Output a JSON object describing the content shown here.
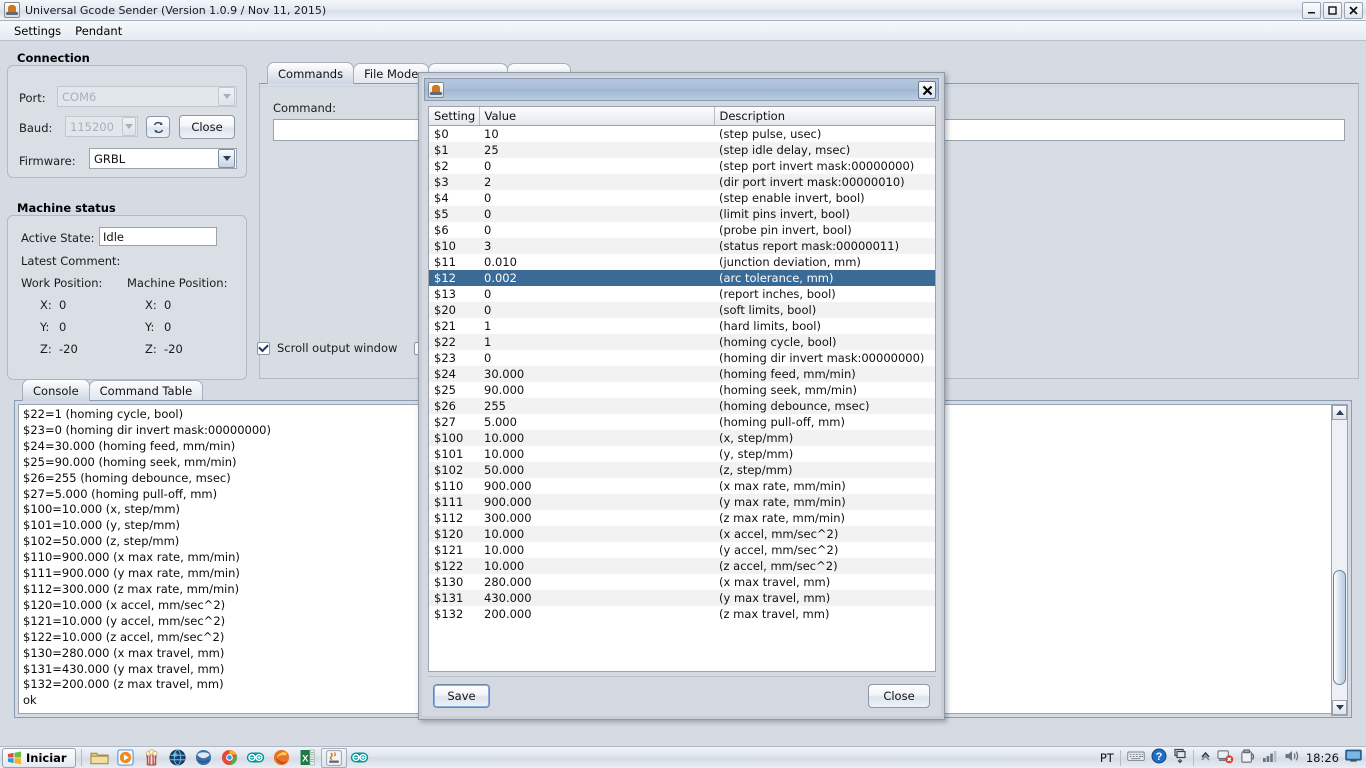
{
  "window": {
    "title": "Universal Gcode Sender (Version 1.0.9 / Nov 11, 2015)",
    "icon": "java-coffee-cup-icon",
    "controls": {
      "minimize": "_",
      "maximize": "□",
      "close": "✕"
    }
  },
  "menubar": {
    "items": [
      "Settings",
      "Pendant"
    ]
  },
  "connection": {
    "title": "Connection",
    "port_label": "Port:",
    "port_value": "COM6",
    "baud_label": "Baud:",
    "baud_value": "115200",
    "refresh_icon": "refresh-icon",
    "close_button": "Close",
    "firmware_label": "Firmware:",
    "firmware_value": "GRBL"
  },
  "machine_status": {
    "title": "Machine status",
    "active_state_label": "Active State:",
    "active_state_value": "Idle",
    "latest_comment_label": "Latest Comment:",
    "work_position_label": "Work Position:",
    "machine_position_label": "Machine Position:",
    "work": {
      "x_label": "X:",
      "x": "0",
      "y_label": "Y:",
      "y": "0",
      "z_label": "Z:",
      "z": "-20"
    },
    "machine": {
      "x_label": "X:",
      "x": "0",
      "y_label": "Y:",
      "y": "0",
      "z_label": "Z:",
      "z": "-20"
    }
  },
  "main_tabs": [
    {
      "label": "Commands",
      "selected": true
    },
    {
      "label": "File Mode",
      "selected": false
    },
    {
      "label": "",
      "selected": false
    },
    {
      "label": "",
      "selected": false
    }
  ],
  "command_panel": {
    "label": "Command:",
    "input_value": "",
    "input_placeholder": ""
  },
  "options": {
    "scroll_output_window": {
      "label": "Scroll output window",
      "checked": true
    },
    "second_checkbox": {
      "label": "",
      "checked": false
    }
  },
  "bottom_tabs": [
    {
      "label": "Console",
      "selected": true
    },
    {
      "label": "Command Table",
      "selected": false
    }
  ],
  "console": {
    "lines": [
      "$22=1 (homing cycle, bool)",
      "$23=0 (homing dir invert mask:00000000)",
      "$24=30.000 (homing feed, mm/min)",
      "$25=90.000 (homing seek, mm/min)",
      "$26=255 (homing debounce, msec)",
      "$27=5.000 (homing pull-off, mm)",
      "$100=10.000 (x, step/mm)",
      "$101=10.000 (y, step/mm)",
      "$102=50.000 (z, step/mm)",
      "$110=900.000 (x max rate, mm/min)",
      "$111=900.000 (y max rate, mm/min)",
      "$112=300.000 (z max rate, mm/min)",
      "$120=10.000 (x accel, mm/sec^2)",
      "$121=10.000 (y accel, mm/sec^2)",
      "$122=10.000 (z accel, mm/sec^2)",
      "$130=280.000 (x max travel, mm)",
      "$131=430.000 (y max travel, mm)",
      "$132=200.000 (z max travel, mm)",
      "ok"
    ]
  },
  "dialog": {
    "title": "",
    "icon": "java-coffee-cup-icon",
    "close_icon": "close-icon",
    "columns": [
      "Setting",
      "Value",
      "Description"
    ],
    "selected_row": 9,
    "rows": [
      [
        "$0",
        "10",
        "(step pulse, usec)"
      ],
      [
        "$1",
        "25",
        "(step idle delay, msec)"
      ],
      [
        "$2",
        "0",
        "(step port invert mask:00000000)"
      ],
      [
        "$3",
        "2",
        "(dir port invert mask:00000010)"
      ],
      [
        "$4",
        "0",
        "(step enable invert, bool)"
      ],
      [
        "$5",
        "0",
        "(limit pins invert, bool)"
      ],
      [
        "$6",
        "0",
        "(probe pin invert, bool)"
      ],
      [
        "$10",
        "3",
        "(status report mask:00000011)"
      ],
      [
        "$11",
        "0.010",
        "(junction deviation, mm)"
      ],
      [
        "$12",
        "0.002",
        "(arc tolerance, mm)"
      ],
      [
        "$13",
        "0",
        "(report inches, bool)"
      ],
      [
        "$20",
        "0",
        "(soft limits, bool)"
      ],
      [
        "$21",
        "1",
        "(hard limits, bool)"
      ],
      [
        "$22",
        "1",
        "(homing cycle, bool)"
      ],
      [
        "$23",
        "0",
        "(homing dir invert mask:00000000)"
      ],
      [
        "$24",
        "30.000",
        "(homing feed, mm/min)"
      ],
      [
        "$25",
        "90.000",
        "(homing seek, mm/min)"
      ],
      [
        "$26",
        "255",
        "(homing debounce, msec)"
      ],
      [
        "$27",
        "5.000",
        "(homing pull-off, mm)"
      ],
      [
        "$100",
        "10.000",
        "(x, step/mm)"
      ],
      [
        "$101",
        "10.000",
        "(y, step/mm)"
      ],
      [
        "$102",
        "50.000",
        "(z, step/mm)"
      ],
      [
        "$110",
        "900.000",
        "(x max rate, mm/min)"
      ],
      [
        "$111",
        "900.000",
        "(y max rate, mm/min)"
      ],
      [
        "$112",
        "300.000",
        "(z max rate, mm/min)"
      ],
      [
        "$120",
        "10.000",
        "(x accel, mm/sec^2)"
      ],
      [
        "$121",
        "10.000",
        "(y accel, mm/sec^2)"
      ],
      [
        "$122",
        "10.000",
        "(z accel, mm/sec^2)"
      ],
      [
        "$130",
        "280.000",
        "(x max travel, mm)"
      ],
      [
        "$131",
        "430.000",
        "(y max travel, mm)"
      ],
      [
        "$132",
        "200.000",
        "(z max travel, mm)"
      ]
    ],
    "save_button": "Save",
    "close_button": "Close"
  },
  "taskbar": {
    "start_label": "Iniciar",
    "start_icon": "windows-flag-icon",
    "quick_launch": [
      "folder-icon",
      "media-player-icon",
      "popcorn-icon",
      "browser-globe-icon",
      "thunderbird-icon",
      "chrome-icon",
      "arduino-icon",
      "firefox-icon",
      "excel-icon",
      "java-app-icon",
      "arduino-icon"
    ],
    "tray": {
      "language": "PT",
      "icons": [
        "keyboard-icon",
        "help-icon",
        "window-switch-icon",
        "chevron-up-icon",
        "network-disconnected-icon",
        "safely-remove-icon",
        "signal-bars-icon",
        "volume-icon"
      ],
      "clock": "18:26",
      "show_desktop": "show-desktop-icon"
    }
  },
  "colors": {
    "selection_blue": "#3a6a96",
    "title_blue": "#a9bed8",
    "panel_gray": "#d6dbe3"
  }
}
